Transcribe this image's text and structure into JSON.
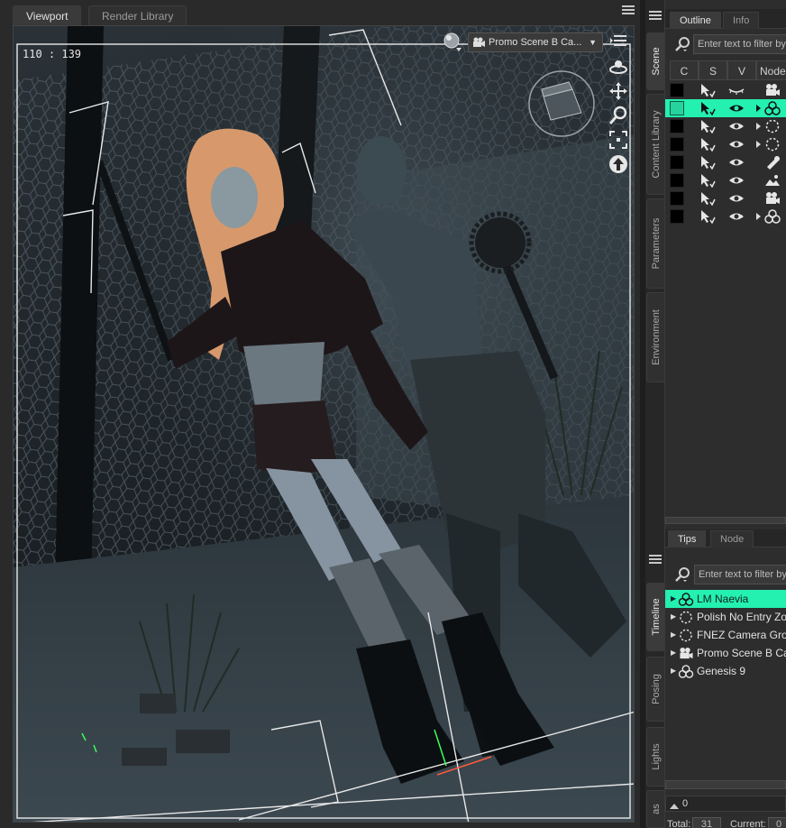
{
  "left_tabs": [
    "Viewport",
    "Render Library"
  ],
  "viewport": {
    "coord_readout": "110 : 139",
    "camera_select": "Promo Scene B Ca...",
    "camera_select_arrow": "▼"
  },
  "right_vertical_tabs_top": [
    "Scene",
    "Content Library",
    "Parameters",
    "Environment"
  ],
  "right_vertical_tabs_bottom": [
    "Timeline",
    "Posing",
    "Lights",
    "as"
  ],
  "scene_panel": {
    "tabs": [
      "Outline",
      "Info"
    ],
    "filter_placeholder": "Enter text to filter by...",
    "columns": [
      "C",
      "S",
      "V",
      "Node"
    ]
  },
  "tips_panel": {
    "tabs": [
      "Tips",
      "Node"
    ]
  },
  "timeline_panel": {
    "filter_placeholder": "Enter text to filter by...",
    "items": [
      {
        "label": "LM Naevia",
        "icon": "figure-icon",
        "selected": true
      },
      {
        "label": "Polish No Entry Zo",
        "icon": "group-icon",
        "selected": false
      },
      {
        "label": "FNEZ Camera Grou",
        "icon": "group-icon",
        "selected": false
      },
      {
        "label": "Promo Scene B Ca",
        "icon": "camera-icon",
        "selected": false
      },
      {
        "label": "Genesis 9",
        "icon": "figure-icon",
        "selected": false
      }
    ],
    "frame_value": "0",
    "total_label": "Total:",
    "total_value": "31",
    "current_label": "Current:",
    "current_value": "0"
  },
  "colors": {
    "selection": "#24f0b0",
    "hair": "#d7996c",
    "panel_bg": "#2d2d2d"
  }
}
